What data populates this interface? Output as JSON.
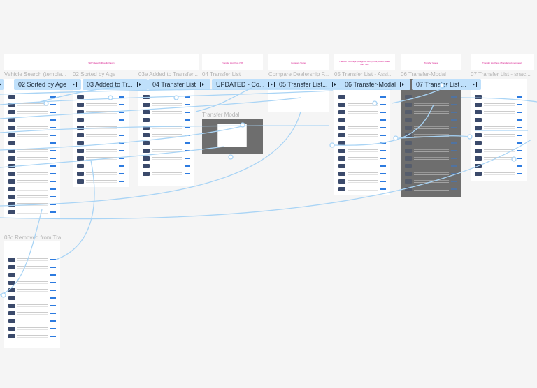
{
  "notes": [
    "SRP (Search Results Page)",
    "Transfer List Page (V8)",
    "Compare Stores",
    "Transfer List Page (Assigned Store) Plus, cases added from SRP",
    "Transfer Modal",
    "Transfer List Page (Transferred members)"
  ],
  "frame_labels": [
    "Vehicle Search (templa...",
    "02 Sorted by Age",
    "03e Added to Transfer...",
    "04 Transfer List",
    "Compare Dealership F...",
    "05 Transfer List - Assi...",
    "06 Transfer-Modal",
    "07 Transfer List - snac...",
    "Transfer Modal",
    "03c Removed from Tra..."
  ],
  "flow_starts": [
    "02 Sorted by Age",
    "03 Added to Tr...",
    "04 Transfer List",
    "UPDATED - Co...",
    "05 Transfer List...",
    "06 Transfer-Modal",
    "07 Transfer List ..."
  ],
  "colors": {
    "canvas": "#f5f5f5",
    "flow": "#a9d4f5",
    "pill": "#bfe0fb",
    "note_text": "#d6158a"
  }
}
